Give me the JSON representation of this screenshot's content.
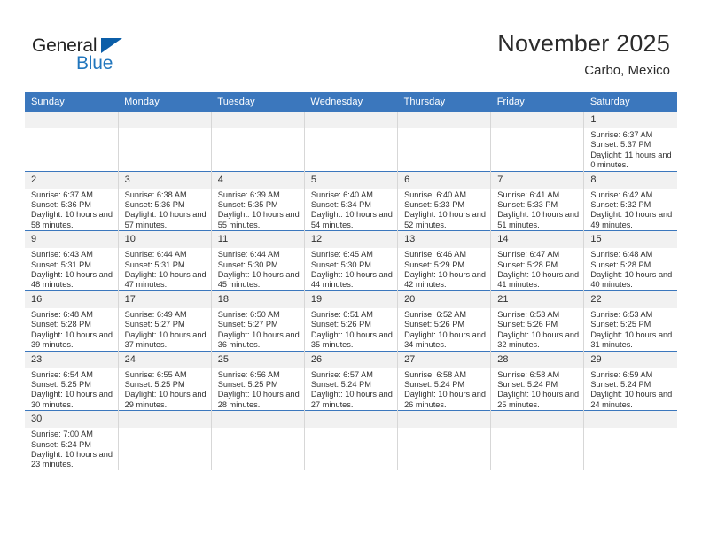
{
  "brand": {
    "name_part1": "General",
    "name_part2": "Blue",
    "triangle_color": "#0b5ea8",
    "blue_text_color": "#2176bd"
  },
  "header": {
    "title": "November 2025",
    "location": "Carbo, Mexico",
    "header_bg_color": "#3b77bd"
  },
  "weekday_headers": [
    "Sunday",
    "Monday",
    "Tuesday",
    "Wednesday",
    "Thursday",
    "Friday",
    "Saturday"
  ],
  "weeks": [
    [
      {
        "day": "",
        "blank": true
      },
      {
        "day": "",
        "blank": true
      },
      {
        "day": "",
        "blank": true
      },
      {
        "day": "",
        "blank": true
      },
      {
        "day": "",
        "blank": true
      },
      {
        "day": "",
        "blank": true
      },
      {
        "day": "1",
        "sunrise": "Sunrise: 6:37 AM",
        "sunset": "Sunset: 5:37 PM",
        "daylight": "Daylight: 11 hours and 0 minutes."
      }
    ],
    [
      {
        "day": "2",
        "sunrise": "Sunrise: 6:37 AM",
        "sunset": "Sunset: 5:36 PM",
        "daylight": "Daylight: 10 hours and 58 minutes."
      },
      {
        "day": "3",
        "sunrise": "Sunrise: 6:38 AM",
        "sunset": "Sunset: 5:36 PM",
        "daylight": "Daylight: 10 hours and 57 minutes."
      },
      {
        "day": "4",
        "sunrise": "Sunrise: 6:39 AM",
        "sunset": "Sunset: 5:35 PM",
        "daylight": "Daylight: 10 hours and 55 minutes."
      },
      {
        "day": "5",
        "sunrise": "Sunrise: 6:40 AM",
        "sunset": "Sunset: 5:34 PM",
        "daylight": "Daylight: 10 hours and 54 minutes."
      },
      {
        "day": "6",
        "sunrise": "Sunrise: 6:40 AM",
        "sunset": "Sunset: 5:33 PM",
        "daylight": "Daylight: 10 hours and 52 minutes."
      },
      {
        "day": "7",
        "sunrise": "Sunrise: 6:41 AM",
        "sunset": "Sunset: 5:33 PM",
        "daylight": "Daylight: 10 hours and 51 minutes."
      },
      {
        "day": "8",
        "sunrise": "Sunrise: 6:42 AM",
        "sunset": "Sunset: 5:32 PM",
        "daylight": "Daylight: 10 hours and 49 minutes."
      }
    ],
    [
      {
        "day": "9",
        "sunrise": "Sunrise: 6:43 AM",
        "sunset": "Sunset: 5:31 PM",
        "daylight": "Daylight: 10 hours and 48 minutes."
      },
      {
        "day": "10",
        "sunrise": "Sunrise: 6:44 AM",
        "sunset": "Sunset: 5:31 PM",
        "daylight": "Daylight: 10 hours and 47 minutes."
      },
      {
        "day": "11",
        "sunrise": "Sunrise: 6:44 AM",
        "sunset": "Sunset: 5:30 PM",
        "daylight": "Daylight: 10 hours and 45 minutes."
      },
      {
        "day": "12",
        "sunrise": "Sunrise: 6:45 AM",
        "sunset": "Sunset: 5:30 PM",
        "daylight": "Daylight: 10 hours and 44 minutes."
      },
      {
        "day": "13",
        "sunrise": "Sunrise: 6:46 AM",
        "sunset": "Sunset: 5:29 PM",
        "daylight": "Daylight: 10 hours and 42 minutes."
      },
      {
        "day": "14",
        "sunrise": "Sunrise: 6:47 AM",
        "sunset": "Sunset: 5:28 PM",
        "daylight": "Daylight: 10 hours and 41 minutes."
      },
      {
        "day": "15",
        "sunrise": "Sunrise: 6:48 AM",
        "sunset": "Sunset: 5:28 PM",
        "daylight": "Daylight: 10 hours and 40 minutes."
      }
    ],
    [
      {
        "day": "16",
        "sunrise": "Sunrise: 6:48 AM",
        "sunset": "Sunset: 5:28 PM",
        "daylight": "Daylight: 10 hours and 39 minutes."
      },
      {
        "day": "17",
        "sunrise": "Sunrise: 6:49 AM",
        "sunset": "Sunset: 5:27 PM",
        "daylight": "Daylight: 10 hours and 37 minutes."
      },
      {
        "day": "18",
        "sunrise": "Sunrise: 6:50 AM",
        "sunset": "Sunset: 5:27 PM",
        "daylight": "Daylight: 10 hours and 36 minutes."
      },
      {
        "day": "19",
        "sunrise": "Sunrise: 6:51 AM",
        "sunset": "Sunset: 5:26 PM",
        "daylight": "Daylight: 10 hours and 35 minutes."
      },
      {
        "day": "20",
        "sunrise": "Sunrise: 6:52 AM",
        "sunset": "Sunset: 5:26 PM",
        "daylight": "Daylight: 10 hours and 34 minutes."
      },
      {
        "day": "21",
        "sunrise": "Sunrise: 6:53 AM",
        "sunset": "Sunset: 5:26 PM",
        "daylight": "Daylight: 10 hours and 32 minutes."
      },
      {
        "day": "22",
        "sunrise": "Sunrise: 6:53 AM",
        "sunset": "Sunset: 5:25 PM",
        "daylight": "Daylight: 10 hours and 31 minutes."
      }
    ],
    [
      {
        "day": "23",
        "sunrise": "Sunrise: 6:54 AM",
        "sunset": "Sunset: 5:25 PM",
        "daylight": "Daylight: 10 hours and 30 minutes."
      },
      {
        "day": "24",
        "sunrise": "Sunrise: 6:55 AM",
        "sunset": "Sunset: 5:25 PM",
        "daylight": "Daylight: 10 hours and 29 minutes."
      },
      {
        "day": "25",
        "sunrise": "Sunrise: 6:56 AM",
        "sunset": "Sunset: 5:25 PM",
        "daylight": "Daylight: 10 hours and 28 minutes."
      },
      {
        "day": "26",
        "sunrise": "Sunrise: 6:57 AM",
        "sunset": "Sunset: 5:24 PM",
        "daylight": "Daylight: 10 hours and 27 minutes."
      },
      {
        "day": "27",
        "sunrise": "Sunrise: 6:58 AM",
        "sunset": "Sunset: 5:24 PM",
        "daylight": "Daylight: 10 hours and 26 minutes."
      },
      {
        "day": "28",
        "sunrise": "Sunrise: 6:58 AM",
        "sunset": "Sunset: 5:24 PM",
        "daylight": "Daylight: 10 hours and 25 minutes."
      },
      {
        "day": "29",
        "sunrise": "Sunrise: 6:59 AM",
        "sunset": "Sunset: 5:24 PM",
        "daylight": "Daylight: 10 hours and 24 minutes."
      }
    ],
    [
      {
        "day": "30",
        "sunrise": "Sunrise: 7:00 AM",
        "sunset": "Sunset: 5:24 PM",
        "daylight": "Daylight: 10 hours and 23 minutes."
      },
      {
        "day": "",
        "blank": true
      },
      {
        "day": "",
        "blank": true
      },
      {
        "day": "",
        "blank": true
      },
      {
        "day": "",
        "blank": true
      },
      {
        "day": "",
        "blank": true
      },
      {
        "day": "",
        "blank": true
      }
    ]
  ]
}
